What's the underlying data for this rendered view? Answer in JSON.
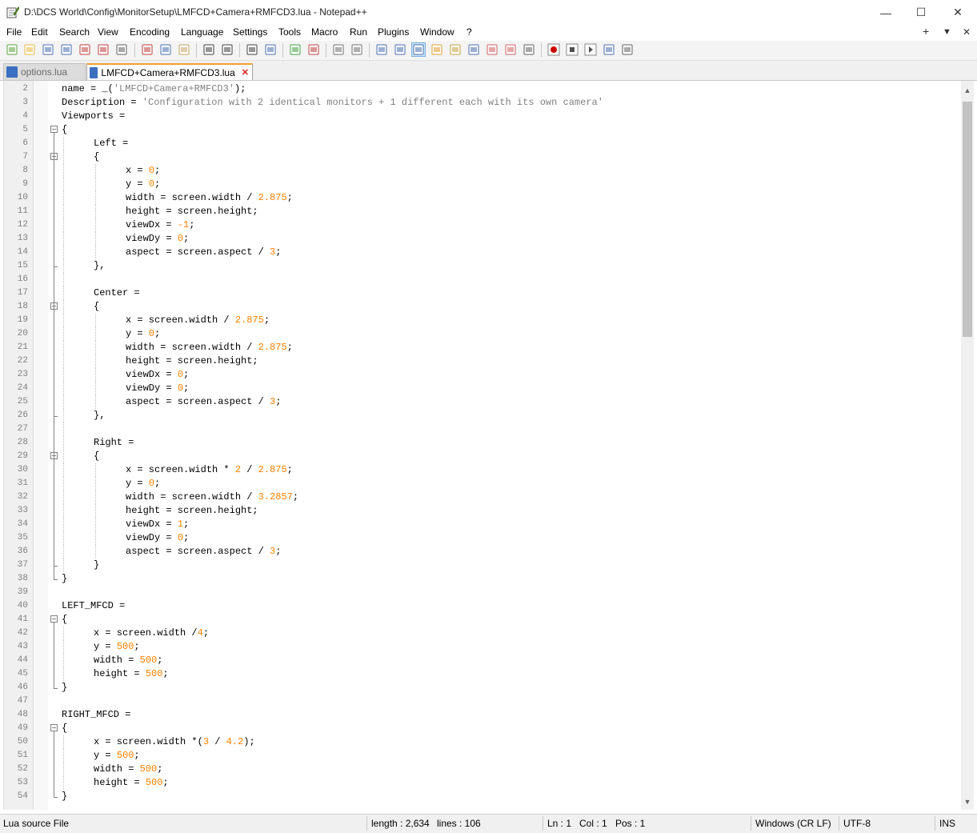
{
  "window": {
    "title": "D:\\DCS World\\Config\\MonitorSetup\\LMFCD+Camera+RMFCD3.lua - Notepad++",
    "minimize": "—",
    "maximize": "☐",
    "close": "✕"
  },
  "menu": {
    "items": [
      "File",
      "Edit",
      "Search",
      "View",
      "Encoding",
      "Language",
      "Settings",
      "Tools",
      "Macro",
      "Run",
      "Plugins",
      "Window",
      "?"
    ],
    "right_plus": "+",
    "right_down": "▼",
    "right_close": "✕"
  },
  "toolbar": {
    "icons": [
      "new-file-icon",
      "open-file-icon",
      "save-icon",
      "save-all-icon",
      "close-icon",
      "close-all-icon",
      "print-icon",
      "cut-icon",
      "copy-icon",
      "paste-icon",
      "undo-icon",
      "redo-icon",
      "find-icon",
      "replace-icon",
      "zoom-in-icon",
      "zoom-out-icon",
      "sync-vertical-icon",
      "sync-horizontal-icon",
      "word-wrap-icon",
      "show-all-chars-icon",
      "indent-guide-icon",
      "udl-icon",
      "doc-map-icon",
      "function-list-icon",
      "folder-workspace-icon",
      "doc-switcher-icon",
      "monitoring-icon",
      "record-macro-icon",
      "stop-macro-icon",
      "play-macro-icon",
      "run-macro-multiple-icon",
      "save-macro-icon"
    ]
  },
  "tabs": [
    {
      "label": "options.lua",
      "active": false
    },
    {
      "label": "LMFCD+Camera+RMFCD3.lua",
      "active": true
    }
  ],
  "editor": {
    "lines": [
      {
        "n": "2",
        "indent": 0,
        "t": [
          [
            "k",
            "name = _("
          ],
          [
            "s",
            "'LMFCD+Camera+RMFCD3'"
          ],
          [
            "k",
            ");"
          ]
        ]
      },
      {
        "n": "3",
        "indent": 0,
        "t": [
          [
            "k",
            "Description = "
          ],
          [
            "s",
            "'Configuration with 2 identical monitors + 1 different each with its own camera'"
          ]
        ]
      },
      {
        "n": "4",
        "indent": 0,
        "t": [
          [
            "k",
            "Viewports ="
          ]
        ]
      },
      {
        "n": "5",
        "indent": 0,
        "t": [
          [
            "k",
            "{"
          ]
        ],
        "fold": "open"
      },
      {
        "n": "6",
        "indent": 1,
        "t": [
          [
            "k",
            "Left ="
          ]
        ]
      },
      {
        "n": "7",
        "indent": 1,
        "t": [
          [
            "k",
            "{"
          ]
        ],
        "fold": "open"
      },
      {
        "n": "8",
        "indent": 2,
        "t": [
          [
            "k",
            "x = "
          ],
          [
            "n",
            "0"
          ],
          [
            "k",
            ";"
          ]
        ]
      },
      {
        "n": "9",
        "indent": 2,
        "t": [
          [
            "k",
            "y = "
          ],
          [
            "n",
            "0"
          ],
          [
            "k",
            ";"
          ]
        ]
      },
      {
        "n": "10",
        "indent": 2,
        "t": [
          [
            "k",
            "width = screen.width / "
          ],
          [
            "n",
            "2.875"
          ],
          [
            "k",
            ";"
          ]
        ]
      },
      {
        "n": "11",
        "indent": 2,
        "t": [
          [
            "k",
            "height = screen.height;"
          ]
        ]
      },
      {
        "n": "12",
        "indent": 2,
        "t": [
          [
            "k",
            "viewDx = "
          ],
          [
            "n",
            "-1"
          ],
          [
            "k",
            ";"
          ]
        ]
      },
      {
        "n": "13",
        "indent": 2,
        "t": [
          [
            "k",
            "viewDy = "
          ],
          [
            "n",
            "0"
          ],
          [
            "k",
            ";"
          ]
        ]
      },
      {
        "n": "14",
        "indent": 2,
        "t": [
          [
            "k",
            "aspect = screen.aspect / "
          ],
          [
            "n",
            "3"
          ],
          [
            "k",
            ";"
          ]
        ]
      },
      {
        "n": "15",
        "indent": 1,
        "t": [
          [
            "k",
            "},"
          ]
        ],
        "fold": "end"
      },
      {
        "n": "16",
        "indent": 1,
        "t": []
      },
      {
        "n": "17",
        "indent": 1,
        "t": [
          [
            "k",
            "Center ="
          ]
        ]
      },
      {
        "n": "18",
        "indent": 1,
        "t": [
          [
            "k",
            "{"
          ]
        ],
        "fold": "open"
      },
      {
        "n": "19",
        "indent": 2,
        "t": [
          [
            "k",
            "x = screen.width / "
          ],
          [
            "n",
            "2.875"
          ],
          [
            "k",
            ";"
          ]
        ]
      },
      {
        "n": "20",
        "indent": 2,
        "t": [
          [
            "k",
            "y = "
          ],
          [
            "n",
            "0"
          ],
          [
            "k",
            ";"
          ]
        ]
      },
      {
        "n": "21",
        "indent": 2,
        "t": [
          [
            "k",
            "width = screen.width / "
          ],
          [
            "n",
            "2.875"
          ],
          [
            "k",
            ";"
          ]
        ]
      },
      {
        "n": "22",
        "indent": 2,
        "t": [
          [
            "k",
            "height = screen.height;"
          ]
        ]
      },
      {
        "n": "23",
        "indent": 2,
        "t": [
          [
            "k",
            "viewDx = "
          ],
          [
            "n",
            "0"
          ],
          [
            "k",
            ";"
          ]
        ]
      },
      {
        "n": "24",
        "indent": 2,
        "t": [
          [
            "k",
            "viewDy = "
          ],
          [
            "n",
            "0"
          ],
          [
            "k",
            ";"
          ]
        ]
      },
      {
        "n": "25",
        "indent": 2,
        "t": [
          [
            "k",
            "aspect = screen.aspect / "
          ],
          [
            "n",
            "3"
          ],
          [
            "k",
            ";"
          ]
        ]
      },
      {
        "n": "26",
        "indent": 1,
        "t": [
          [
            "k",
            "},"
          ]
        ],
        "fold": "end"
      },
      {
        "n": "27",
        "indent": 1,
        "t": []
      },
      {
        "n": "28",
        "indent": 1,
        "t": [
          [
            "k",
            "Right ="
          ]
        ]
      },
      {
        "n": "29",
        "indent": 1,
        "t": [
          [
            "k",
            "{"
          ]
        ],
        "fold": "open"
      },
      {
        "n": "30",
        "indent": 2,
        "t": [
          [
            "k",
            "x = screen.width * "
          ],
          [
            "n",
            "2"
          ],
          [
            "k",
            " / "
          ],
          [
            "n",
            "2.875"
          ],
          [
            "k",
            ";"
          ]
        ]
      },
      {
        "n": "31",
        "indent": 2,
        "t": [
          [
            "k",
            "y = "
          ],
          [
            "n",
            "0"
          ],
          [
            "k",
            ";"
          ]
        ]
      },
      {
        "n": "32",
        "indent": 2,
        "t": [
          [
            "k",
            "width = screen.width / "
          ],
          [
            "n",
            "3.2857"
          ],
          [
            "k",
            ";"
          ]
        ]
      },
      {
        "n": "33",
        "indent": 2,
        "t": [
          [
            "k",
            "height = screen.height;"
          ]
        ]
      },
      {
        "n": "34",
        "indent": 2,
        "t": [
          [
            "k",
            "viewDx = "
          ],
          [
            "n",
            "1"
          ],
          [
            "k",
            ";"
          ]
        ]
      },
      {
        "n": "35",
        "indent": 2,
        "t": [
          [
            "k",
            "viewDy = "
          ],
          [
            "n",
            "0"
          ],
          [
            "k",
            ";"
          ]
        ]
      },
      {
        "n": "36",
        "indent": 2,
        "t": [
          [
            "k",
            "aspect = screen.aspect / "
          ],
          [
            "n",
            "3"
          ],
          [
            "k",
            ";"
          ]
        ]
      },
      {
        "n": "37",
        "indent": 1,
        "t": [
          [
            "k",
            "}"
          ]
        ],
        "fold": "end"
      },
      {
        "n": "38",
        "indent": 0,
        "t": [
          [
            "k",
            "}"
          ]
        ],
        "fold": "end"
      },
      {
        "n": "39",
        "indent": 0,
        "t": []
      },
      {
        "n": "40",
        "indent": 0,
        "t": [
          [
            "k",
            "LEFT_MFCD ="
          ]
        ]
      },
      {
        "n": "41",
        "indent": 0,
        "t": [
          [
            "k",
            "{"
          ]
        ],
        "fold": "open"
      },
      {
        "n": "42",
        "indent": 1,
        "t": [
          [
            "k",
            "x = screen.width /"
          ],
          [
            "n",
            "4"
          ],
          [
            "k",
            ";"
          ]
        ]
      },
      {
        "n": "43",
        "indent": 1,
        "t": [
          [
            "k",
            "y = "
          ],
          [
            "n",
            "500"
          ],
          [
            "k",
            ";"
          ]
        ]
      },
      {
        "n": "44",
        "indent": 1,
        "t": [
          [
            "k",
            "width = "
          ],
          [
            "n",
            "500"
          ],
          [
            "k",
            ";"
          ]
        ]
      },
      {
        "n": "45",
        "indent": 1,
        "t": [
          [
            "k",
            "height = "
          ],
          [
            "n",
            "500"
          ],
          [
            "k",
            ";"
          ]
        ]
      },
      {
        "n": "46",
        "indent": 0,
        "t": [
          [
            "k",
            "}"
          ]
        ],
        "fold": "end"
      },
      {
        "n": "47",
        "indent": 0,
        "t": []
      },
      {
        "n": "48",
        "indent": 0,
        "t": [
          [
            "k",
            "RIGHT_MFCD ="
          ]
        ]
      },
      {
        "n": "49",
        "indent": 0,
        "t": [
          [
            "k",
            "{"
          ]
        ],
        "fold": "open"
      },
      {
        "n": "50",
        "indent": 1,
        "t": [
          [
            "k",
            "x = screen.width *("
          ],
          [
            "n",
            "3"
          ],
          [
            "k",
            " / "
          ],
          [
            "n",
            "4.2"
          ],
          [
            "k",
            ");"
          ]
        ]
      },
      {
        "n": "51",
        "indent": 1,
        "t": [
          [
            "k",
            "y = "
          ],
          [
            "n",
            "500"
          ],
          [
            "k",
            ";"
          ]
        ]
      },
      {
        "n": "52",
        "indent": 1,
        "t": [
          [
            "k",
            "width = "
          ],
          [
            "n",
            "500"
          ],
          [
            "k",
            ";"
          ]
        ]
      },
      {
        "n": "53",
        "indent": 1,
        "t": [
          [
            "k",
            "height = "
          ],
          [
            "n",
            "500"
          ],
          [
            "k",
            ";"
          ]
        ]
      },
      {
        "n": "54",
        "indent": 0,
        "t": [
          [
            "k",
            "}"
          ]
        ],
        "fold": "end"
      }
    ]
  },
  "status": {
    "filetype": "Lua source File",
    "length": "length : 2,634",
    "lines": "lines : 106",
    "ln": "Ln : 1",
    "col": "Col : 1",
    "pos": "Pos : 1",
    "eol": "Windows (CR LF)",
    "encoding": "UTF-8",
    "mode": "INS"
  }
}
